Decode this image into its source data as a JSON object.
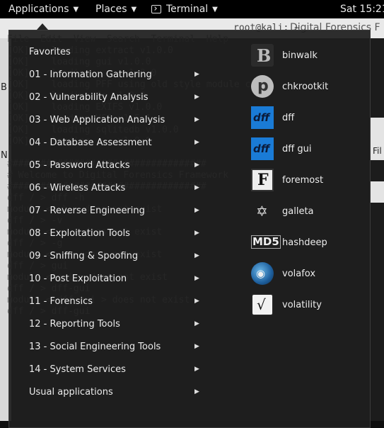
{
  "topbar": {
    "applications": "Applications",
    "places": "Places",
    "terminal": "Terminal",
    "clock": "Sat 15:21"
  },
  "background_window": {
    "title": "Digital Forensics F",
    "side_letters": [
      "B",
      "N"
    ],
    "right_letters": "Fil",
    "terminal_lines": [
      "root@kali: ~",
      "File  Edit  View  Search  Terminal  Help",
      "[OK]    loading extract v1.0.0",
      "[OK]    loading gui v1.0.0",
      "[OK]    loading ...  v1.0.0",
      "[OK]    loading PFF using old style module check",
      "[OK]    loading fs v1.0.0",
      "[OK]    loading EXIFS v1.0.0",
      "[OK]    loading VSS v1.5.1",
      "[OK]    loading sqlitedb v1.0.0",
      "[OK]    loading ... v1.0.0",
      "",
      "####################################",
      "# Welcome to Digital Forensics Framework",
      "####################################",
      "dff / > dff -h",
      "module < -h > does not exist",
      "dff / > -v",
      "module < -v > does not exist",
      "dff / > -g",
      "module < -g > does not exist",
      "dff / > gui",
      "module < gui > does not exist",
      "dff / > dff-gui",
      "module < dff-gui > does not exist",
      "dff / > dff-gui"
    ]
  },
  "menu": {
    "categories": [
      {
        "label": "Favorites",
        "has_submenu": false
      },
      {
        "label": "01 - Information Gathering",
        "has_submenu": true
      },
      {
        "label": "02 - Vulnerability Analysis",
        "has_submenu": true
      },
      {
        "label": "03 - Web Application Analysis",
        "has_submenu": true
      },
      {
        "label": "04 - Database Assessment",
        "has_submenu": true
      },
      {
        "label": "05 - Password Attacks",
        "has_submenu": true
      },
      {
        "label": "06 - Wireless Attacks",
        "has_submenu": true
      },
      {
        "label": "07 - Reverse Engineering",
        "has_submenu": true
      },
      {
        "label": "08 - Exploitation Tools",
        "has_submenu": true
      },
      {
        "label": "09 - Sniffing & Spoofing",
        "has_submenu": true
      },
      {
        "label": "10 - Post Exploitation",
        "has_submenu": true
      },
      {
        "label": "11 - Forensics",
        "has_submenu": true
      },
      {
        "label": "12 - Reporting Tools",
        "has_submenu": true
      },
      {
        "label": "13 - Social Engineering Tools",
        "has_submenu": true
      },
      {
        "label": "14 - System Services",
        "has_submenu": true
      },
      {
        "label": "Usual applications",
        "has_submenu": true
      }
    ],
    "apps": [
      {
        "label": "binwalk",
        "icon": "binwalk-icon",
        "glyph": "B"
      },
      {
        "label": "chkrootkit",
        "icon": "chkrootkit-icon",
        "glyph": "p"
      },
      {
        "label": "dff",
        "icon": "dff-icon",
        "glyph": "dff"
      },
      {
        "label": "dff gui",
        "icon": "dff-gui-icon",
        "glyph": "dff"
      },
      {
        "label": "foremost",
        "icon": "foremost-icon",
        "glyph": "F"
      },
      {
        "label": "galleta",
        "icon": "galleta-icon",
        "glyph": "✡"
      },
      {
        "label": "hashdeep",
        "icon": "hashdeep-icon",
        "glyph": "MD5"
      },
      {
        "label": "volafox",
        "icon": "volafox-icon",
        "glyph": "◉"
      },
      {
        "label": "volatility",
        "icon": "volatility-icon",
        "glyph": "√"
      }
    ]
  },
  "colors": {
    "topbar_bg": "#000000",
    "menu_bg": "#1e1e1e",
    "text": "#ececec",
    "dff_blue": "#1a7bd6"
  }
}
